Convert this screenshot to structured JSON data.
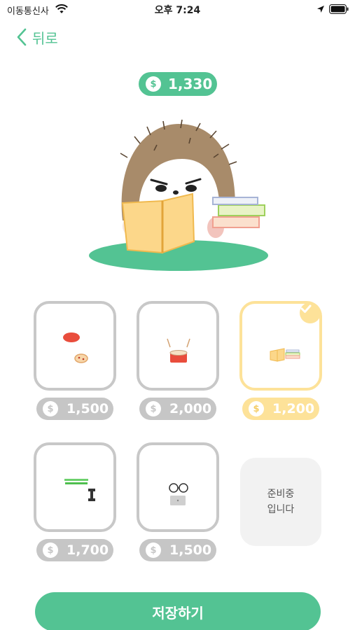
{
  "status_bar": {
    "carrier": "이동통신사",
    "time": "오후 7:24"
  },
  "header": {
    "back_label": "뒤로"
  },
  "balance": {
    "amount": "1,330",
    "currency_symbol": "$"
  },
  "items": [
    {
      "name": "frisbee",
      "price": "1,500",
      "selected": false
    },
    {
      "name": "drum",
      "price": "2,000",
      "selected": false
    },
    {
      "name": "books",
      "price": "1,200",
      "selected": true
    },
    {
      "name": "dumbbell",
      "price": "1,700",
      "selected": false
    },
    {
      "name": "glasses-laptop",
      "price": "1,500",
      "selected": false
    }
  ],
  "coming_soon": {
    "line1": "준비중",
    "line2": "입니다"
  },
  "footer": {
    "save_label": "저장하기"
  },
  "colors": {
    "accent": "#53c393",
    "selected": "#fde299",
    "card_border": "#c8c8c8"
  }
}
